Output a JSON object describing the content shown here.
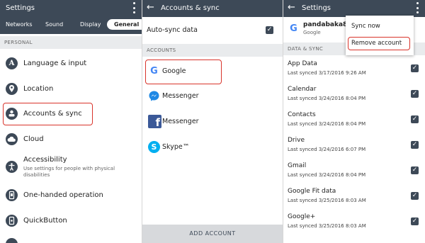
{
  "panel1": {
    "title": "Settings",
    "tabs": [
      {
        "label": "Networks"
      },
      {
        "label": "Sound"
      },
      {
        "label": "Display"
      },
      {
        "label": "General"
      }
    ],
    "section": "PERSONAL",
    "items": [
      {
        "label": "Language & input",
        "icon": "A"
      },
      {
        "label": "Location",
        "icon": "location-pin-icon"
      },
      {
        "label": "Accounts & sync",
        "icon": "accounts-icon"
      },
      {
        "label": "Cloud",
        "icon": "cloud-icon"
      },
      {
        "label": "Accessibility",
        "sub": "Use settings for people with physical disabilities",
        "icon": "accessibility-icon"
      },
      {
        "label": "One-handed operation",
        "icon": "one-hand-icon"
      },
      {
        "label": "QuickButton",
        "icon": "quickbutton-icon"
      }
    ]
  },
  "panel2": {
    "title": "Accounts & sync",
    "auto_sync_label": "Auto-sync data",
    "section": "ACCOUNTS",
    "accounts": [
      {
        "label": "Google",
        "icon": "google-icon"
      },
      {
        "label": "Messenger",
        "icon": "messenger-icon"
      },
      {
        "label": "Messenger",
        "icon": "facebook-icon"
      },
      {
        "label": "Skype™",
        "icon": "skype-icon"
      }
    ],
    "add_account": "ADD ACCOUNT"
  },
  "panel3": {
    "title": "Settings",
    "account_name": "pandabaka8",
    "account_type": "Google",
    "section": "DATA & SYNC",
    "menu": {
      "sync_now": "Sync now",
      "remove_account": "Remove account"
    },
    "items": [
      {
        "title": "App Data",
        "sub": "Last synced 3/17/2016 9:26 AM"
      },
      {
        "title": "Calendar",
        "sub": "Last synced 3/24/2016 8:04 PM"
      },
      {
        "title": "Contacts",
        "sub": "Last synced 3/24/2016 8:04 PM"
      },
      {
        "title": "Drive",
        "sub": "Last synced 3/24/2016 6:07 PM"
      },
      {
        "title": "Gmail",
        "sub": "Last synced 3/24/2016 8:04 PM"
      },
      {
        "title": "Google Fit data",
        "sub": "Last synced 3/25/2016 8:03 AM"
      },
      {
        "title": "Google+",
        "sub": "Last synced 3/25/2016 8:03 AM"
      }
    ]
  },
  "colors": {
    "header": "#3d4957",
    "highlight": "#d9342b"
  }
}
